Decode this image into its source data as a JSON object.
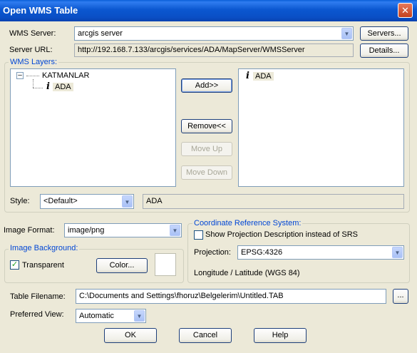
{
  "window": {
    "title": "Open WMS Table",
    "close_glyph": "✕"
  },
  "wms_server": {
    "label": "WMS Server:",
    "value": "arcgis server",
    "servers_button": "Servers..."
  },
  "server_url": {
    "label": "Server URL:",
    "value": "http://192.168.7.133/arcgis/services/ADA/MapServer/WMSServer",
    "details_button": "Details..."
  },
  "wms_layers": {
    "title": "WMS Layers:",
    "tree": {
      "expander": "⊟",
      "root": "KATMANLAR",
      "child": "ADA"
    },
    "selected": [
      "ADA"
    ],
    "buttons": {
      "add": "Add>>",
      "remove": "Remove<<",
      "move_up": "Move Up",
      "move_down": "Move Down"
    },
    "style_label": "Style:",
    "style_value": "<Default>",
    "style_display": "ADA"
  },
  "image_format": {
    "label": "Image Format:",
    "value": "image/png"
  },
  "image_background": {
    "title": "Image Background:",
    "transparent_label": "Transparent",
    "transparent_checked": true,
    "color_button": "Color...",
    "swatch_color": "#ffffff"
  },
  "crs": {
    "title": "Coordinate Reference System:",
    "show_projection_label": "Show Projection Description instead of SRS",
    "show_projection_checked": false,
    "projection_label": "Projection:",
    "projection_value": "EPSG:4326",
    "projection_description": "Longitude / Latitude (WGS 84)"
  },
  "table_filename": {
    "label": "Table Filename:",
    "value": "C:\\Documents and Settings\\fhoruz\\Belgelerim\\Untitled.TAB",
    "browse_button": "..."
  },
  "preferred_view": {
    "label": "Preferred View:",
    "value": "Automatic"
  },
  "footer": {
    "ok": "OK",
    "cancel": "Cancel",
    "help": "Help"
  },
  "icons": {
    "info": "i",
    "check": "✓",
    "dropdown": "▼"
  },
  "colors": {
    "title_bar": "#0a55d0",
    "group_title": "#0046d5",
    "dialog_bg": "#ece9d8",
    "checkbox_check": "#21a121"
  }
}
